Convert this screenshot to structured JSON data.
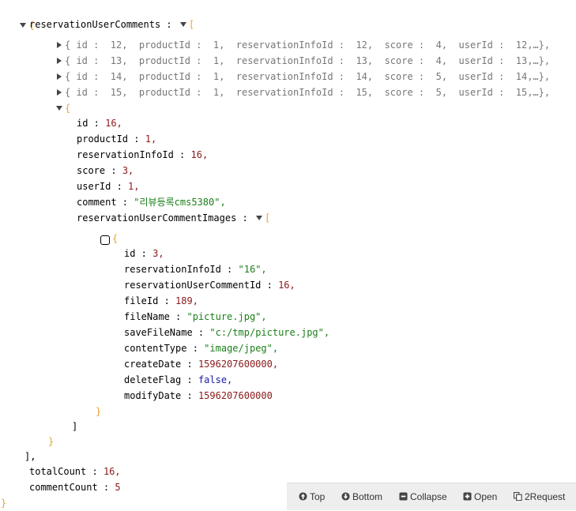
{
  "json_view": {
    "root_open": "{",
    "root_close": "}",
    "comments_key": "reservationUserComments",
    "comments_open": "[",
    "comments_close": "],",
    "collapsed_items": [
      {
        "preview": "{ id :  12,  productId :  1,  reservationInfoId :  12,  score :  4,  userId :  12,…},"
      },
      {
        "preview": "{ id :  13,  productId :  1,  reservationInfoId :  13,  score :  4,  userId :  13,…},"
      },
      {
        "preview": "{ id :  14,  productId :  1,  reservationInfoId :  14,  score :  5,  userId :  14,…},"
      },
      {
        "preview": "{ id :  15,  productId :  1,  reservationInfoId :  15,  score :  5,  userId :  15,…},"
      }
    ],
    "expanded_item": {
      "open": "{",
      "close": "}",
      "fields": {
        "id_key": "id",
        "id_val": "16,",
        "productId_key": "productId",
        "productId_val": "1,",
        "reservationInfoId_key": "reservationInfoId",
        "reservationInfoId_val": "16,",
        "score_key": "score",
        "score_val": "3,",
        "userId_key": "userId",
        "userId_val": "1,",
        "comment_key": "comment",
        "comment_val": "\"리뷰등록cms5380\",",
        "images_key": "reservationUserCommentImages",
        "images_open": "[",
        "images_close": "]"
      },
      "image": {
        "open": "{",
        "close": "}",
        "id_key": "id",
        "id_val": "3,",
        "reservationInfoId_key": "reservationInfoId",
        "reservationInfoId_val": "\"16\",",
        "reservationUserCommentId_key": "reservationUserCommentId",
        "reservationUserCommentId_val": "16,",
        "fileId_key": "fileId",
        "fileId_val": "189,",
        "fileName_key": "fileName",
        "fileName_val": "\"picture.jpg\",",
        "saveFileName_key": "saveFileName",
        "saveFileName_val": "\"c:/tmp/picture.jpg\",",
        "contentType_key": "contentType",
        "contentType_val": "\"image/jpeg\",",
        "createDate_key": "createDate",
        "createDate_val": "1596207600000,",
        "deleteFlag_key": "deleteFlag",
        "deleteFlag_val": "false,",
        "modifyDate_key": "modifyDate",
        "modifyDate_val": "1596207600000"
      }
    },
    "totalCount_key": "totalCount",
    "totalCount_val": "16,",
    "commentCount_key": "commentCount",
    "commentCount_val": "5",
    "separator": " : "
  },
  "toolbar": {
    "top_label": "Top",
    "bottom_label": "Bottom",
    "collapse_label": "Collapse",
    "open_label": "Open",
    "request_label": "2Request"
  },
  "colors": {
    "number": "#8b1a1a",
    "string": "#1a7f1a",
    "boolean": "#1a1aa6",
    "brace": "#e6a23c",
    "toolbar_bg": "#eeeeee"
  }
}
